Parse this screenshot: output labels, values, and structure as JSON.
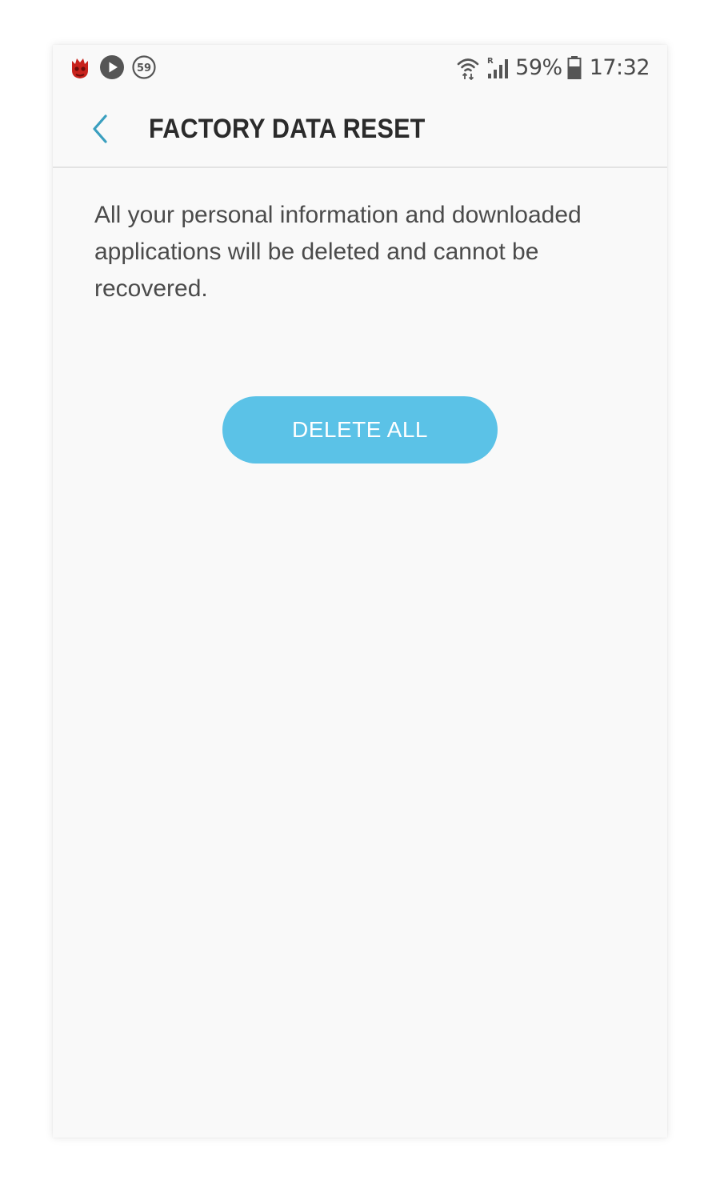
{
  "status_bar": {
    "notification_icons": [
      "antutu-icon",
      "play-icon",
      "counter-59-icon"
    ],
    "counter_badge": "59",
    "signal_roaming": "R",
    "battery_percent": "59%",
    "time": "17:32"
  },
  "header": {
    "title": "FACTORY DATA RESET",
    "back_icon": "chevron-left-icon"
  },
  "main": {
    "description": "All your personal information and downloaded applications will be deleted and cannot be recovered.",
    "delete_button_label": "DELETE ALL"
  },
  "colors": {
    "accent": "#5bc2e7",
    "back_icon": "#3a9fbf",
    "background": "#f9f9f9",
    "title_text": "#2b2b2b",
    "body_text": "#4b4b4b"
  }
}
